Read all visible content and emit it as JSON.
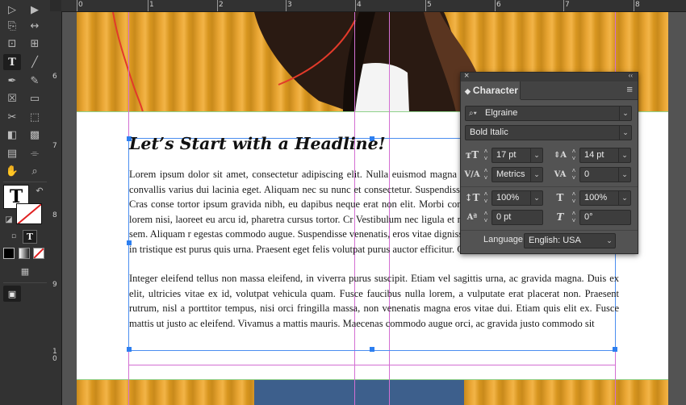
{
  "ruler": {
    "top_labels": [
      "0",
      "1",
      "2",
      "3",
      "4",
      "5",
      "6",
      "7",
      "8"
    ],
    "left_labels": [
      "6",
      "7",
      "8",
      "9",
      "1\n0"
    ]
  },
  "toolbar": {
    "tools": [
      "selection-tool",
      "direct-selection-tool",
      "page-tool",
      "gap-tool",
      "content-collector-tool",
      "content-placer-tool",
      "type-tool",
      "line-tool",
      "pen-tool",
      "pencil-tool",
      "rectangle-frame-tool",
      "rectangle-tool",
      "scissors-tool",
      "free-transform-tool",
      "gradient-swatch-tool",
      "gradient-feather-tool",
      "note-tool",
      "eyedropper-tool",
      "hand-tool",
      "zoom-tool"
    ],
    "fill_stroke_glyph": "T",
    "format_text_glyph": "T"
  },
  "document": {
    "headline": "Let’s Start with a Headline!",
    "paragraph1": "Lorem ipsum dolor sit amet, consectetur adipiscing elit. Nulla euismod magna vel quet. Donec aliquam mattis tellus, convallis varius dui lacinia eget. Aliquam nec su nunc et consectetur. Suspendisse vel nunc id urna consectetur gravida. Cras conse tortor ipsum gravida nibh, eu dapibus neque erat non elit. Morbi convallis purus el at finibus dui. Aliquam lorem nisi, laoreet eu arcu id, pharetra cursus tortor. Cr Vestibulum nec ligula et nulla gravida venenatis. Donec ut tortor sem. Aliquam r egestas commodo augue. Suspendisse venenatis, eros vitae dignissim commodo, mi libero tincidunt felis, in tristique est purus quis urna. Praesent eget felis volutpat purus auctor efficitur. Cras a mi eros.",
    "paragraph2": "Integer eleifend tellus non massa eleifend, in viverra purus suscipit. Etiam vel sagittis urna, ac gravida magna. Duis ex elit, ultricies vitae ex id, volutpat vehicula quam. Fusce faucibus nulla lorem, a vulputate erat placerat non. Praesent rutrum, nisl a porttitor tempus, nisi orci fringilla massa, non venenatis magna eros vitae dui. Etiam quis elit ex. Fusce mattis ut justo ac eleifend. Vivamus a mattis mauris. Maecenas commodo augue orci, ac gravida justo commodo sit"
  },
  "character_panel": {
    "close_glyph": "×",
    "collapse_glyph": "‹‹",
    "title": "Character",
    "menu_glyph": "≡",
    "font_family": "Elgraine",
    "font_style": "Bold Italic",
    "font_size": "17 pt",
    "leading": "14 pt",
    "kerning": "Metrics",
    "tracking": "0",
    "vertical_scale": "100%",
    "horizontal_scale": "100%",
    "baseline_shift": "0 pt",
    "skew": "0°",
    "language_label": "Language:",
    "language": "English: USA"
  },
  "colors": {
    "panel_bg": "#535353",
    "guide": "#d36fd2",
    "frame_selection": "#4b8ef0",
    "photo_orange": "#e9a634"
  }
}
